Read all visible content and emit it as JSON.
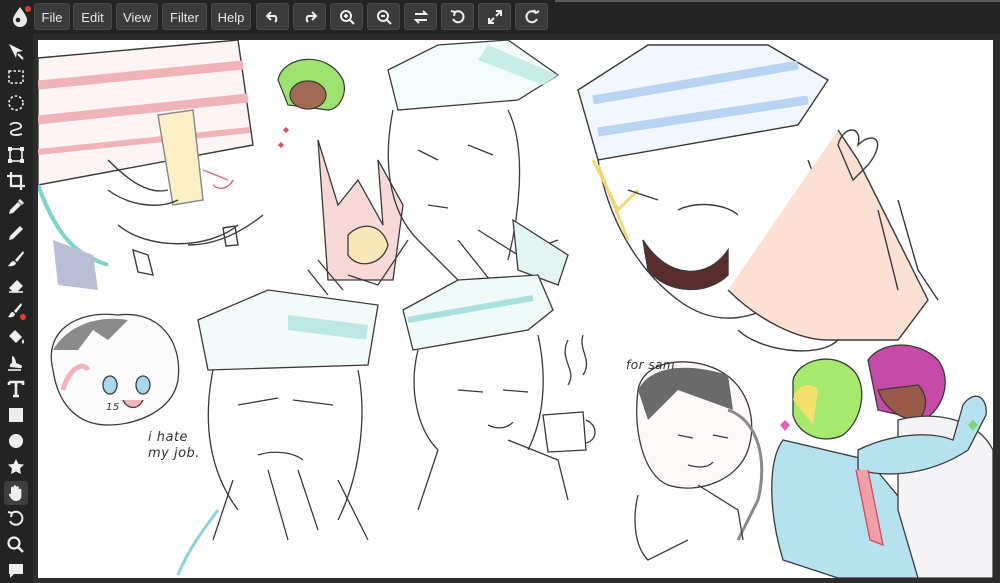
{
  "menu": {
    "file": "File",
    "edit": "Edit",
    "view": "View",
    "filter": "Filter",
    "help": "Help"
  },
  "toolbar_icons": [
    "undo-icon",
    "redo-icon",
    "zoom-in-icon",
    "zoom-out-icon",
    "flip-icon",
    "rotate-left-icon",
    "fullscreen-icon",
    "refresh-icon"
  ],
  "sidebar_tools": [
    "move-icon",
    "rect-select-icon",
    "ellipse-select-icon",
    "lasso-icon",
    "transform-icon",
    "crop-icon",
    "eyedropper-icon",
    "pencil-icon",
    "brush-icon",
    "eraser-icon",
    "clone-brush-icon",
    "fill-bucket-icon",
    "smudge-icon",
    "text-icon",
    "rectangle-shape-icon",
    "ellipse-shape-icon",
    "star-shape-icon",
    "hand-icon",
    "rotate-canvas-icon",
    "zoom-icon",
    "comment-icon"
  ],
  "active_tool": "hand-icon",
  "canvas_text": {
    "quote": "i hate\nmy job.",
    "dedication": "for sam",
    "badge_number": "15"
  },
  "colors": {
    "app_bg": "#2a2a2a",
    "toolbar_bg": "#232323",
    "button_bg": "#3b3b3b",
    "accent_red": "#e03c31",
    "canvas_bg": "#ffffff"
  }
}
